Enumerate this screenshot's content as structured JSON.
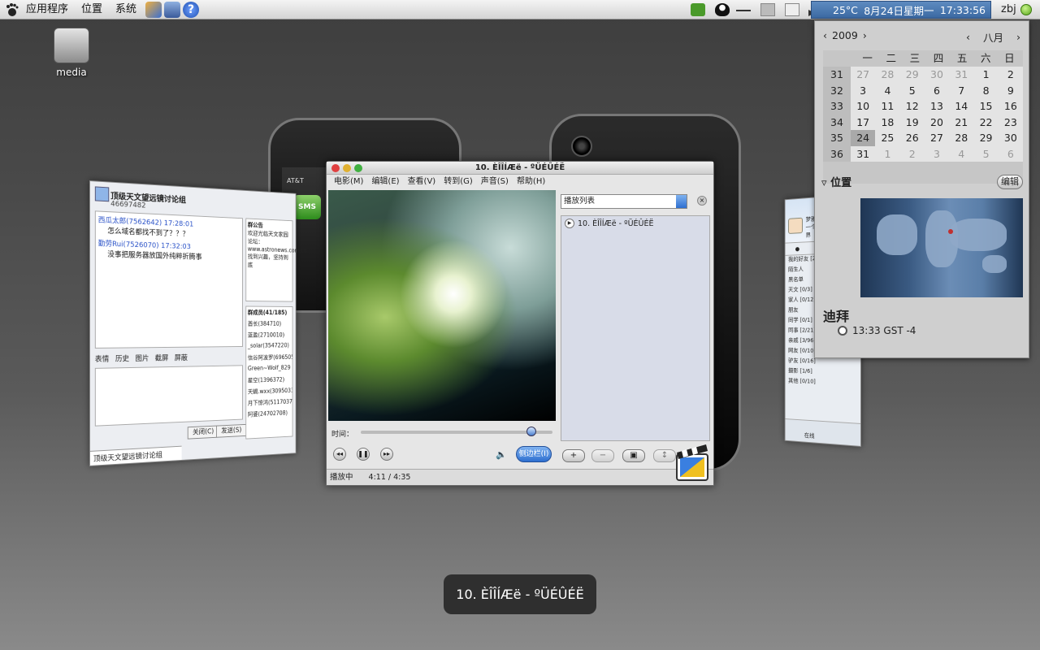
{
  "top_panel": {
    "menus": [
      "应用程序",
      "位置",
      "系统"
    ],
    "weather": "25°C",
    "date": "8月24日星期一",
    "time": "17:33:56",
    "username": "zbj"
  },
  "desktop": {
    "media_label": "media"
  },
  "phone": {
    "carrier": "AT&T",
    "app_label": "SMS"
  },
  "qq_group": {
    "title": "顶级天文望远镜讨论组",
    "group_id": "46697482",
    "messages": [
      {
        "sender": "西瓜太郎(7562642) 17:28:01",
        "text": "怎么域名都找不到了？？？"
      },
      {
        "sender": "勤劳Rui(7526070) 17:32:03",
        "text": "没事把服务器放国外纯粹折腾事"
      }
    ],
    "toolbar": [
      "表情",
      "历史",
      "图片",
      "截屏",
      "屏蔽"
    ],
    "close_btn": "关闭(C)",
    "send_btn": "发送(S)",
    "notice_title": "群公告",
    "notice_text": "欢迎光临天文家园论坛：www.astronews.com.cn 找到兴趣，坚持到底",
    "members_title": "群成员(41/185)",
    "members": [
      "酋长(384710)",
      "蓝盈(2710010)",
      "_solar(3547220)",
      "信谷阿波罗(6965050)",
      "Green~Wolf_829",
      "星空(1396372)",
      "天蝎.wxx(30950330)",
      "月下惊鸿(51170370)",
      "阿婆(24702708)"
    ],
    "tab_label": "顶级天文望远镜讨论组"
  },
  "totem": {
    "title": "10. ÈÎÎÍÆë - ºÜÉÛÉË",
    "menus": [
      "电影(M)",
      "编辑(E)",
      "查看(V)",
      "转到(G)",
      "声音(S)",
      "帮助(H)"
    ],
    "seek_label": "时间：",
    "seek_progress": 0.89,
    "sidebar_btn": "侧边栏(I)",
    "playlist_combo": "播放列表",
    "playlist": [
      "10. ÈÎÎÍÆë - ºÜÉÛÉË"
    ],
    "status": "播放中",
    "position": "4:11 / 4:35"
  },
  "qq_list": {
    "nickname": "梦雅",
    "signature": "一个人的行囊,走遍世界",
    "groups": [
      "我的好友 [2/6]",
      "陌生人",
      "黑名单",
      "天文 [0/3]",
      "家人 [0/12]",
      "朋友",
      "同学 [0/1]",
      "同事 [2/21]",
      "亲戚 [3/96]",
      "网友 [0/10]",
      "驴友 [0/16]",
      "摄影 [1/6]",
      "其他 [0/10]"
    ],
    "status_label": "在线"
  },
  "calendar": {
    "year": "2009",
    "month": "八月",
    "day_names": [
      "一",
      "二",
      "三",
      "四",
      "五",
      "六",
      "日"
    ],
    "week_numbers": [
      "31",
      "32",
      "33",
      "34",
      "35",
      "36"
    ],
    "weeks": [
      [
        "27",
        "28",
        "29",
        "30",
        "31",
        "1",
        "2"
      ],
      [
        "3",
        "4",
        "5",
        "6",
        "7",
        "8",
        "9"
      ],
      [
        "10",
        "11",
        "12",
        "13",
        "14",
        "15",
        "16"
      ],
      [
        "17",
        "18",
        "19",
        "20",
        "21",
        "22",
        "23"
      ],
      [
        "24",
        "25",
        "26",
        "27",
        "28",
        "29",
        "30"
      ],
      [
        "31",
        "1",
        "2",
        "3",
        "4",
        "5",
        "6"
      ]
    ],
    "locations_title": "位置",
    "edit_btn": "编辑",
    "city": "迪拜",
    "city_time": "13:33 GST -4"
  },
  "switcher": {
    "tip": "10. ÈÎÎÍÆë - ºÜÉÛÉË"
  },
  "colors": {
    "panel_clock_bg": "#3c6aa3",
    "accent_blue": "#2e6fd0",
    "status_green": "#58a51b"
  }
}
